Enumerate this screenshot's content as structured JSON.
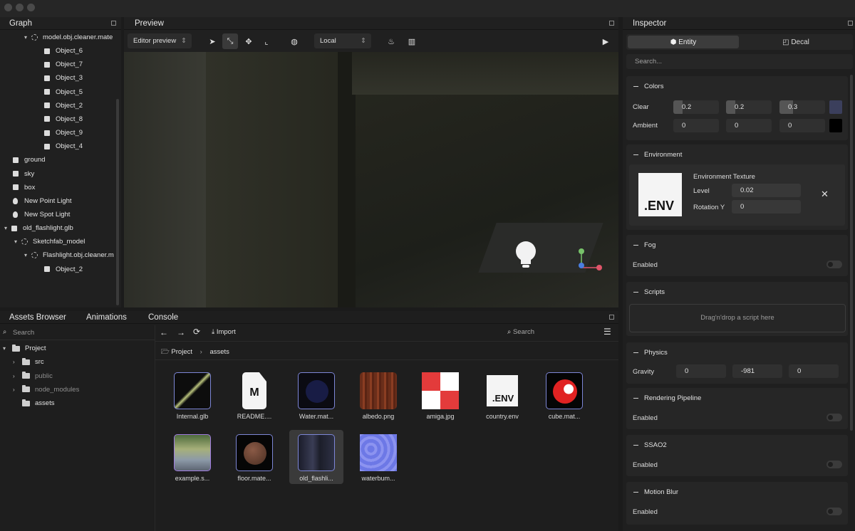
{
  "graph": {
    "title": "Graph",
    "items": [
      {
        "label": "model.obj.cleaner.mate",
        "icon": "node-icon",
        "chev": "▾"
      },
      {
        "label": "Object_6",
        "icon": "cube-icon"
      },
      {
        "label": "Object_7",
        "icon": "cube-icon"
      },
      {
        "label": "Object_3",
        "icon": "cube-icon"
      },
      {
        "label": "Object_5",
        "icon": "cube-icon"
      },
      {
        "label": "Object_2",
        "icon": "cube-icon"
      },
      {
        "label": "Object_8",
        "icon": "cube-icon"
      },
      {
        "label": "Object_9",
        "icon": "cube-icon"
      },
      {
        "label": "Object_4",
        "icon": "cube-icon"
      },
      {
        "label": "ground",
        "icon": "cube-icon"
      },
      {
        "label": "sky",
        "icon": "cube-icon"
      },
      {
        "label": "box",
        "icon": "cube-icon"
      },
      {
        "label": "New Point Light",
        "icon": "light-icon"
      },
      {
        "label": "New Spot Light",
        "icon": "light-icon"
      },
      {
        "label": "old_flashlight.glb",
        "icon": "cube-icon",
        "chev": "▾"
      },
      {
        "label": "Sketchfab_model",
        "icon": "node-icon",
        "chev": "▾"
      },
      {
        "label": "Flashlight.obj.cleaner.m",
        "icon": "node-icon",
        "chev": "▾"
      },
      {
        "label": "Object_2",
        "icon": "cube-icon"
      }
    ]
  },
  "preview": {
    "title": "Preview",
    "mode": "Editor preview",
    "space": "Local"
  },
  "inspector": {
    "title": "Inspector",
    "tab_entity": "Entity",
    "tab_decal": "Decal",
    "search_placeholder": "Search...",
    "colors": {
      "title": "Colors",
      "clear_label": "Clear",
      "clear": [
        "0.2",
        "0.2",
        "0.3"
      ],
      "clear_swatch": "#3b3f5c",
      "ambient_label": "Ambient",
      "ambient": [
        "0",
        "0",
        "0"
      ],
      "ambient_swatch": "#000000"
    },
    "environment": {
      "title": "Environment",
      "thumb_text": ".ENV",
      "texture_label": "Environment Texture",
      "level_label": "Level",
      "level_value": "0.02",
      "rotation_label": "Rotation Y",
      "rotation_value": "0"
    },
    "fog": {
      "title": "Fog",
      "enabled_label": "Enabled"
    },
    "scripts": {
      "title": "Scripts",
      "drop_text": "Drag'n'drop a script here"
    },
    "physics": {
      "title": "Physics",
      "gravity_label": "Gravity",
      "gravity": [
        "0",
        "-981",
        "0"
      ]
    },
    "rendering": {
      "title": "Rendering Pipeline",
      "enabled_label": "Enabled"
    },
    "ssao": {
      "title": "SSAO2",
      "enabled_label": "Enabled"
    },
    "motion_blur": {
      "title": "Motion Blur",
      "enabled_label": "Enabled"
    }
  },
  "bottom_tabs": [
    "Assets Browser",
    "Animations",
    "Console"
  ],
  "assets": {
    "search_placeholder": "Search",
    "import_label": "Import",
    "search2_placeholder": "Search",
    "crumb_root": "Project",
    "crumb_current": "assets",
    "tree": [
      {
        "label": "Project",
        "chev": "▾"
      },
      {
        "label": "src",
        "chev": "›"
      },
      {
        "label": "public",
        "chev": "›"
      },
      {
        "label": "node_modules",
        "chev": "›"
      },
      {
        "label": "assets",
        "chev": ""
      }
    ],
    "files": [
      "Internal.glb",
      "README....",
      "Water.mat...",
      "albedo.png",
      "amiga.jpg",
      "country.env",
      "cube.mat...",
      "example.s...",
      "floor.mate...",
      "old_flashli...",
      "waterbum..."
    ],
    "readme_letter": "M",
    "env_thumb_text": ".ENV"
  }
}
